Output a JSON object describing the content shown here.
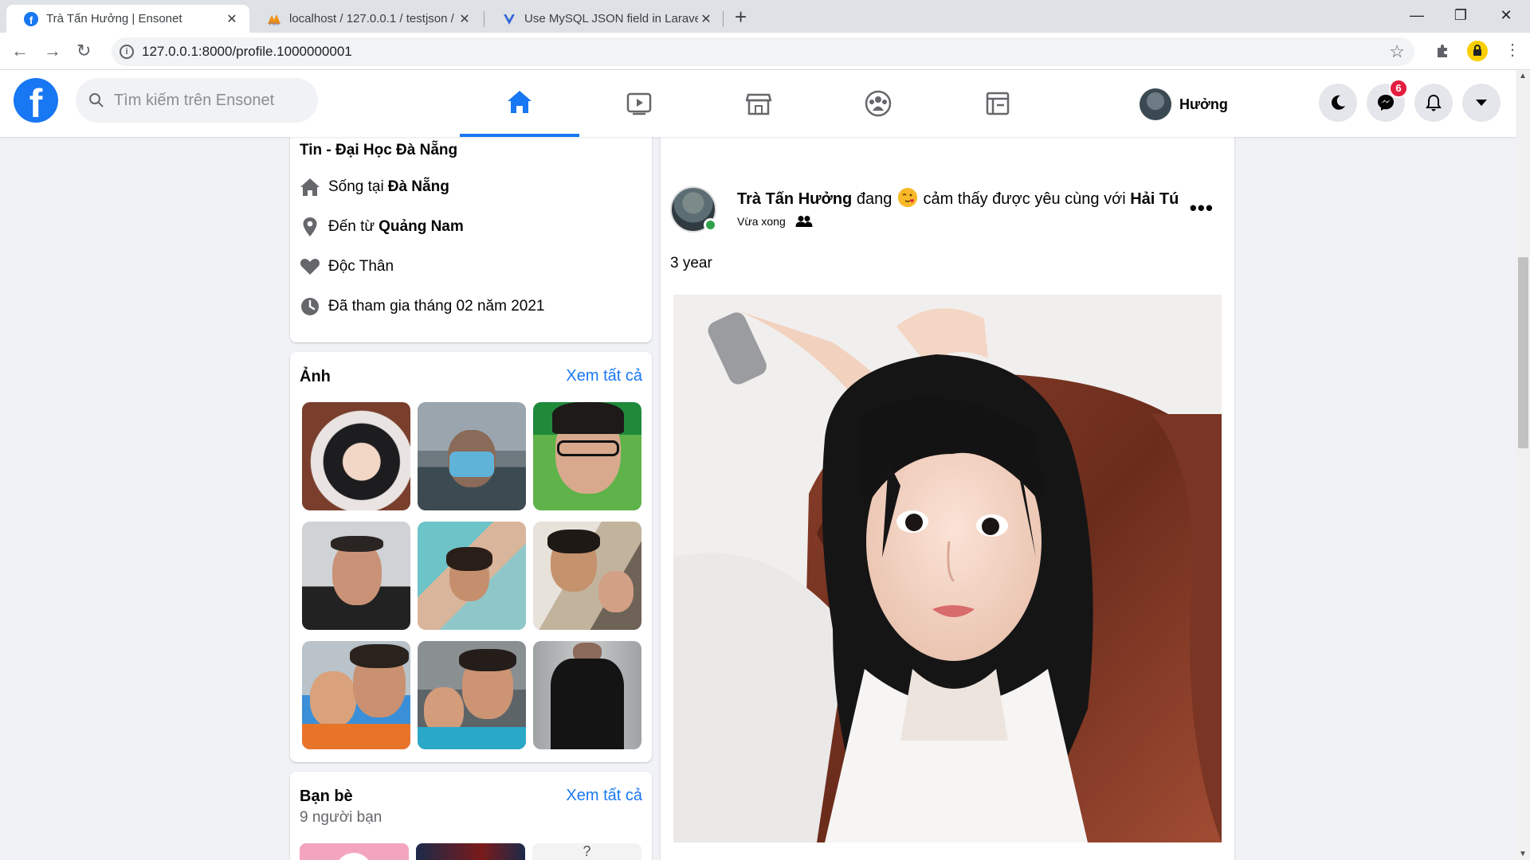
{
  "browser": {
    "tabs": [
      {
        "title": "Trà Tấn Hưởng | Ensonet"
      },
      {
        "title": "localhost / 127.0.0.1 / testjson / s"
      },
      {
        "title": "Use MySQL JSON field in Laravel"
      }
    ],
    "url": "127.0.0.1:8000/profile.1000000001"
  },
  "header": {
    "logo": "f",
    "search_placeholder": "Tìm kiếm trên Ensonet",
    "nav": [
      "home-icon",
      "video-icon",
      "marketplace-icon",
      "groups-icon",
      "pages-icon"
    ],
    "active_nav": "home-icon",
    "user_name": "Hưởng",
    "messenger_badge": "6"
  },
  "intro": {
    "work": "Tin - Đại Học Đà Nẵng",
    "lives_prefix": "Sống tại",
    "lives_city": "Đà Nẵng",
    "from_prefix": "Đến từ",
    "from_city": "Quảng Nam",
    "relationship": "Độc Thân",
    "joined": "Đã tham gia tháng 02 năm 2021"
  },
  "photos": {
    "title": "Ảnh",
    "see_all": "Xem tất cả",
    "items": [
      "photo-1",
      "photo-2",
      "photo-3",
      "photo-4",
      "photo-5",
      "photo-6",
      "photo-7",
      "photo-8",
      "photo-9"
    ]
  },
  "friends": {
    "title": "Bạn bè",
    "count": "9 người bạn",
    "see_all": "Xem tất cả"
  },
  "post": {
    "author": "Trà Tấn Hưởng",
    "feeling_prefix": "đang",
    "feeling": "cảm thấy được yêu",
    "with_text": "cùng với",
    "tagged": "Hải Tú",
    "time": "Vừa xong",
    "audience_icon": "friends-icon",
    "text": "3 year",
    "more": "•••"
  },
  "colors": {
    "brand": "#1877f2",
    "online": "#31a24c",
    "badge": "#e41e3f"
  }
}
